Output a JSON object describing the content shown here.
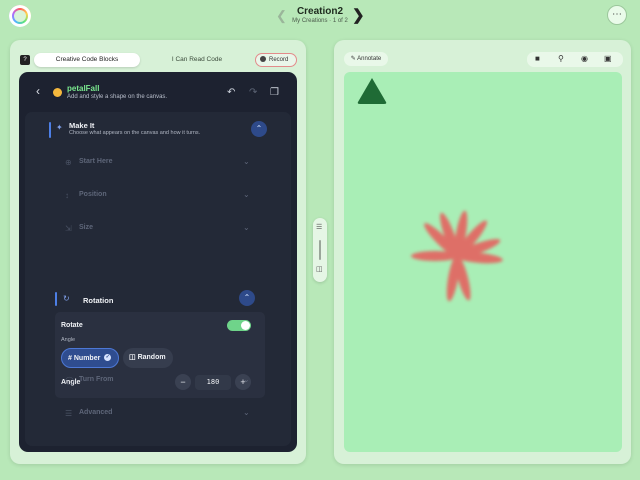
{
  "topbar": {
    "title": "Creation2",
    "subtitle": "My Creations · 1 of 2",
    "prev_icon": "chevron-left-icon",
    "next_icon": "chevron-right-icon",
    "menu_icon": "ellipsis-icon"
  },
  "left": {
    "tabs": [
      {
        "label": "Creative Code Blocks",
        "active": true
      },
      {
        "label": "I Can Read Code",
        "active": false
      }
    ],
    "record_label": "Record"
  },
  "block": {
    "name": "petalFall",
    "description": "Add and style a shape on the canvas.",
    "color": "#f5b83d"
  },
  "make_it": {
    "title": "Make It",
    "description": "Choose what appears on the canvas and how it turns."
  },
  "sections": [
    {
      "label": "Start Here",
      "icon": "crosshair-icon"
    },
    {
      "label": "Position",
      "icon": "move-icon"
    },
    {
      "label": "Size",
      "icon": "resize-icon"
    },
    {
      "label": "Turn From",
      "icon": "pivot-icon"
    },
    {
      "label": "Advanced",
      "icon": "sliders-icon"
    }
  ],
  "rotation": {
    "title": "Rotation",
    "rotate_label": "Rotate",
    "rotate_on": true,
    "angle_sub_label": "Angle",
    "options": [
      "Number",
      "Random"
    ],
    "selected_option": "Number",
    "angle_label": "Angle",
    "angle_value": "180",
    "minus": "−",
    "plus": "+"
  },
  "right": {
    "annotate_label": "Annotate",
    "toolbar_icons": [
      "stop-icon",
      "zoom-icon",
      "camera-icon",
      "gallery-icon"
    ]
  },
  "colors": {
    "accent_blue": "#4d7fe6",
    "toggle_green": "#6fd48a",
    "canvas_bg": "#a9eeb6",
    "petal_red": "#e85a5a",
    "triangle_green": "#1f6b35"
  }
}
